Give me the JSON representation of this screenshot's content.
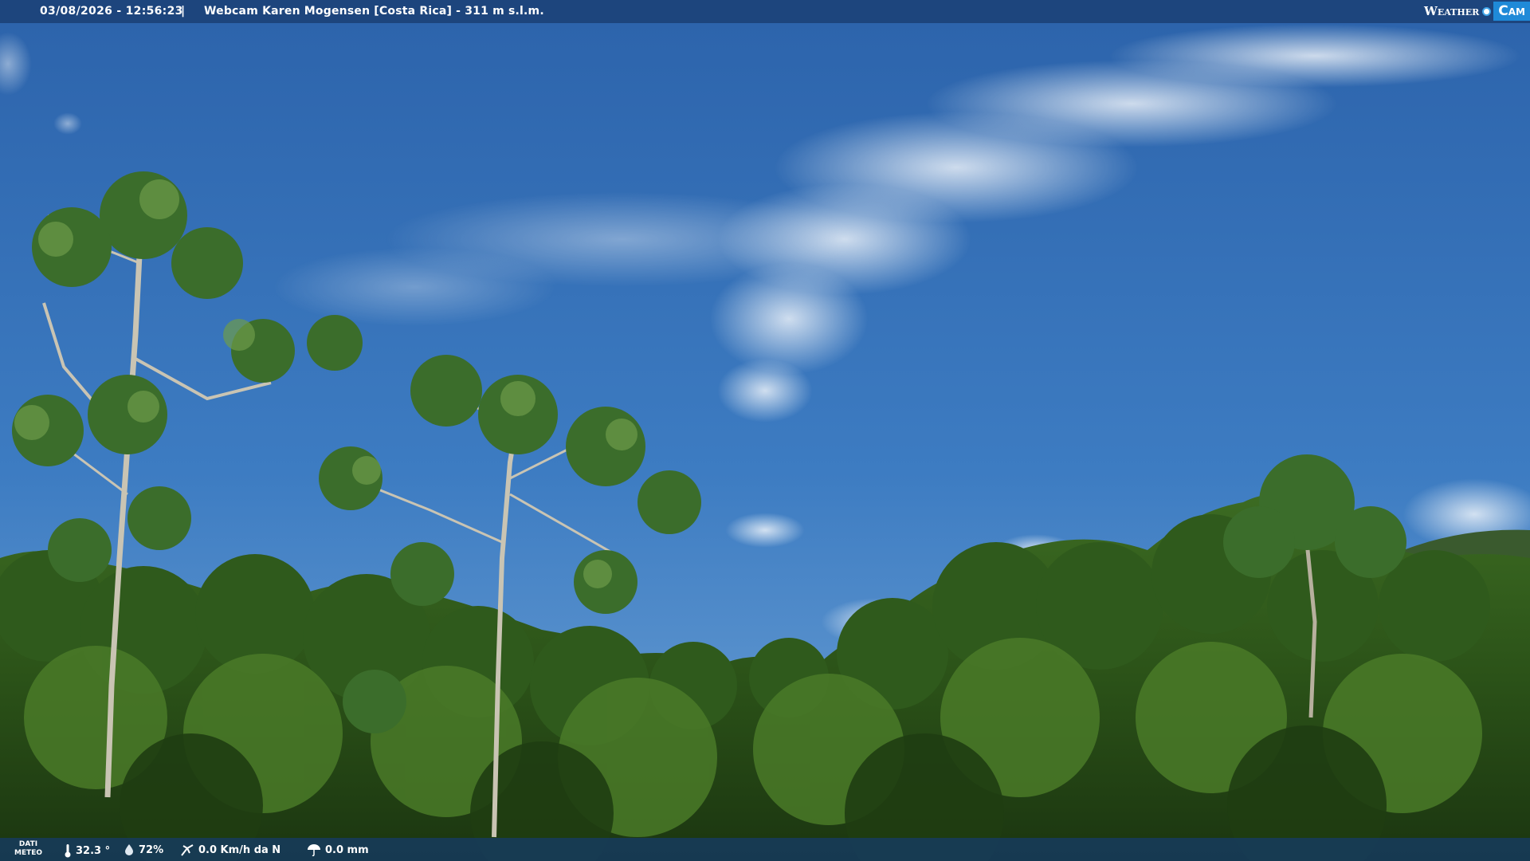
{
  "header": {
    "timestamp": "03/08/2026 - 12:56:23",
    "separator": "|",
    "camera_title": "Webcam Karen Mogensen [Costa Rica]  - 311 m s.l.m."
  },
  "logo": {
    "part1": "Weather",
    "part2": "Cam"
  },
  "weather": {
    "label_line1": "DATI",
    "label_line2": "METEO",
    "temperature": "32.3 °",
    "humidity": "72%",
    "wind": "0.0 Km/h da N",
    "rain": "0.0 mm"
  },
  "colors": {
    "sky_top": "#2f6cb6",
    "sky_bottom": "#5b95d0",
    "forest_dark": "#1e3a14",
    "forest_mid": "#2f5a1c",
    "forest_light": "#4f7d2a",
    "bar": "#1c4278"
  }
}
